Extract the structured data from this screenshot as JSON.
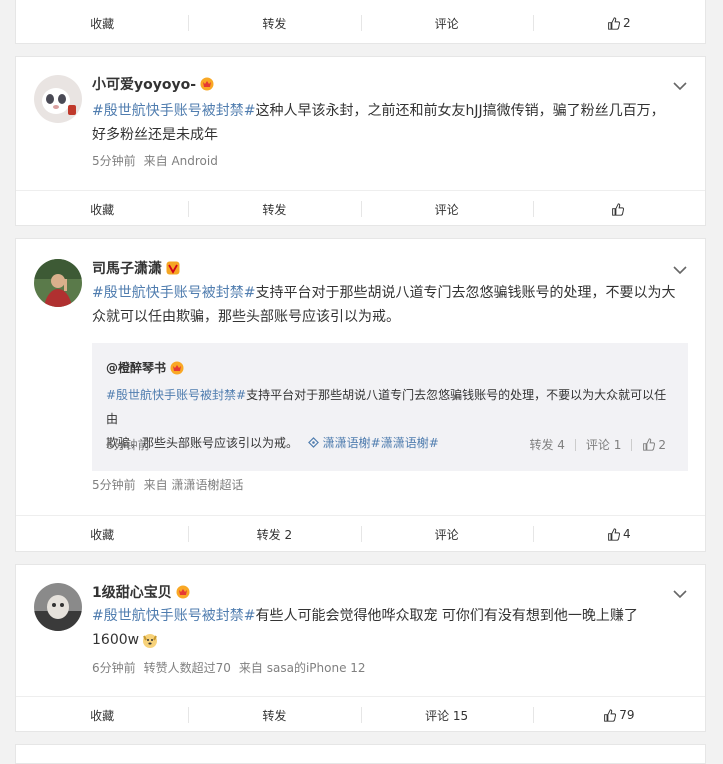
{
  "posts": [
    {
      "actions": {
        "collect": "收藏",
        "repost": "转发",
        "comment": "评论",
        "like_count": "2"
      }
    },
    {
      "username": "小可爱yoyoyo-",
      "text_tag": "#殷世航快手账号被封禁#",
      "text_body_1": "这种人早该永封，之前还和前女友hJJ搞微传销，骗了粉丝几百万，",
      "text_body_2": "好多粉丝还是未成年",
      "time": "5分钟前",
      "source": "来自 Android",
      "actions": {
        "collect": "收藏",
        "repost": "转发",
        "comment": "评论",
        "like_count": ""
      }
    },
    {
      "username": "司馬子潇潇",
      "text_tag": "#殷世航快手账号被封禁#",
      "text_body_1": "支持平台对于那些胡说八道专门去忽悠骗钱账号的处理，不要以为大",
      "text_body_2": "众就可以任由欺骗，那些头部账号应该引以为戒。",
      "quote": {
        "username": "@橙醉琴书",
        "tag": "#殷世航快手账号被封禁#",
        "body_1": "支持平台对于那些胡说八道专门去忽悠骗钱账号的处理，不要以为大众就可以任由",
        "body_2": "欺骗，那些头部账号应该引以为戒。",
        "link": "潇潇语榭#潇潇语榭#",
        "time": "6分钟前",
        "repost": "转发 4",
        "comment": "评论 1",
        "like_count": "2"
      },
      "time": "5分钟前",
      "source": "来自 潇潇语榭超话",
      "actions": {
        "collect": "收藏",
        "repost": "转发 2",
        "comment": "评论",
        "like_count": "4"
      }
    },
    {
      "username": "1级甜心宝贝",
      "text_tag": "#殷世航快手账号被封禁#",
      "text_body_1": "有些人可能会觉得他哗众取宠 可你们有没有想到他一晚上赚了",
      "text_body_2": "1600w",
      "time": "6分钟前",
      "extra": "转赞人数超过70",
      "source": "来自 sasa的iPhone 12",
      "actions": {
        "collect": "收藏",
        "repost": "转发",
        "comment": "评论 15",
        "like_count": "79"
      }
    }
  ]
}
